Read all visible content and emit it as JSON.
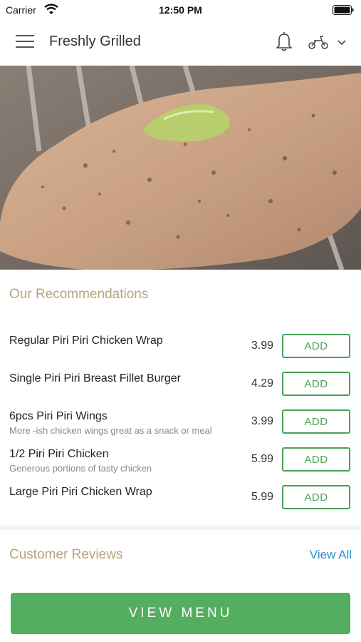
{
  "status_bar": {
    "carrier": "Carrier",
    "time": "12:50 PM",
    "icons": [
      "wifi-icon",
      "battery-icon"
    ]
  },
  "header": {
    "title": "Freshly Grilled",
    "icons": [
      "menu-icon",
      "bell-icon",
      "scooter-icon",
      "chevron-down-icon"
    ]
  },
  "recommendations": {
    "title": "Our Recommendations",
    "add_label": "ADD",
    "items": [
      {
        "name": "Regular Piri Piri Chicken Wrap",
        "description": "",
        "price": "3.99"
      },
      {
        "name": "Single Piri Piri Breast Fillet Burger",
        "description": "",
        "price": "4.29"
      },
      {
        "name": "6pcs Piri Piri Wings",
        "description": "More -ish chicken wings great as a snack or meal",
        "price": "3.99"
      },
      {
        "name": "1/2 Piri Piri Chicken",
        "description": "Generous portions of tasty chicken",
        "price": "5.99"
      },
      {
        "name": "Large Piri Piri Chicken Wrap",
        "description": "",
        "price": "5.99"
      }
    ]
  },
  "reviews": {
    "title": "Customer Reviews",
    "view_all": "View All"
  },
  "footer": {
    "view_menu": "VIEW MENU"
  },
  "colors": {
    "accent_green": "#53ae5f",
    "section_title": "#b5a57c",
    "link_blue": "#2e93c6"
  }
}
